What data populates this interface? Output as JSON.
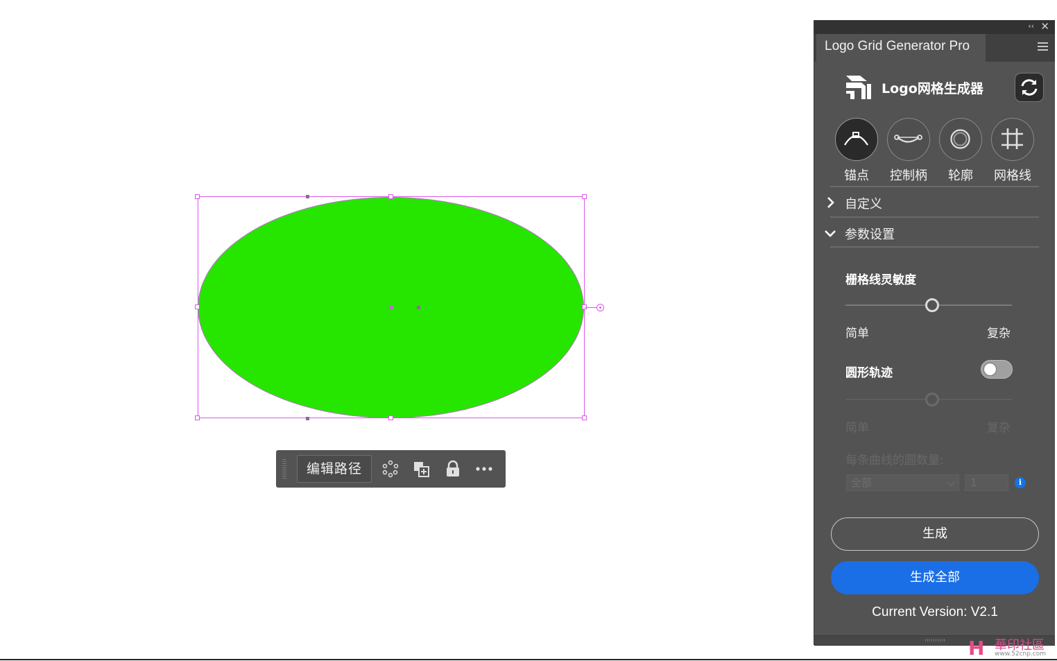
{
  "artwork": {
    "shape": "ellipse",
    "fill_color": "#26e600",
    "selection_color": "#d957e8"
  },
  "context_toolbar": {
    "edit_path_label": "编辑路径",
    "icons": [
      "recolor-icon",
      "duplicate-icon",
      "lock-icon",
      "more-icon"
    ]
  },
  "panel": {
    "tab_title": "Logo Grid Generator Pro",
    "brand_name": "Logo网格生成器",
    "modes": [
      {
        "label": "锚点",
        "icon": "anchor-point-icon",
        "active": true
      },
      {
        "label": "控制柄",
        "icon": "control-handle-icon",
        "active": false
      },
      {
        "label": "轮廓",
        "icon": "outline-icon",
        "active": false
      },
      {
        "label": "网格线",
        "icon": "grid-lines-icon",
        "active": false
      }
    ],
    "sections": {
      "custom": "自定义",
      "params": "参数设置"
    },
    "grid_sensitivity": {
      "label": "栅格线灵敏度",
      "min_label": "简单",
      "max_label": "复杂",
      "value_fraction": 0.52
    },
    "circle_track": {
      "label": "圆形轨迹",
      "enabled": false,
      "min_label": "简单",
      "max_label": "复杂",
      "value_fraction": 0.52
    },
    "circles_per_curve": {
      "label": "每条曲线的圆数量:",
      "select_value": "全部",
      "number_value": "1"
    },
    "generate_label": "生成",
    "generate_all_label": "生成全部",
    "version_text": "Current Version: V2.1",
    "accent_color": "#1a6ee6"
  },
  "watermark": {
    "name": "華印社區",
    "url": "www.52cnp.com"
  }
}
